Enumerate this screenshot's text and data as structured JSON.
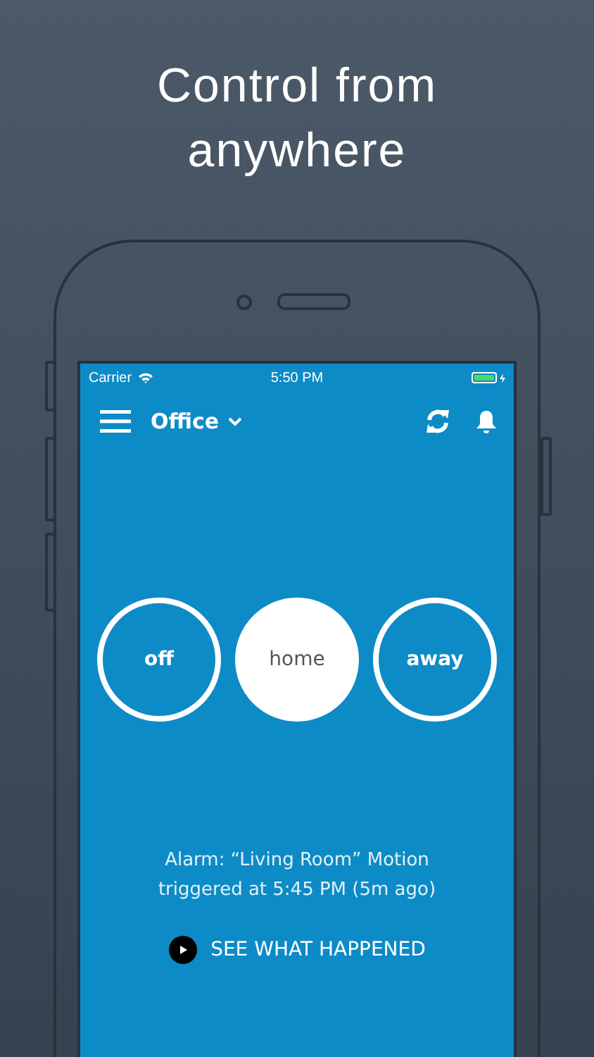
{
  "headline": [
    "Control from",
    "anywhere"
  ],
  "status_bar": {
    "carrier": "Carrier",
    "time": "5:50 PM"
  },
  "nav": {
    "location": "Office"
  },
  "modes": [
    {
      "label": "off",
      "selected": false
    },
    {
      "label": "home",
      "selected": true
    },
    {
      "label": "away",
      "selected": false
    }
  ],
  "alarm": {
    "message": "Alarm: “Living Room” Motion triggered at 5:45 PM (5m ago)",
    "action": "SEE WHAT HAPPENED"
  }
}
